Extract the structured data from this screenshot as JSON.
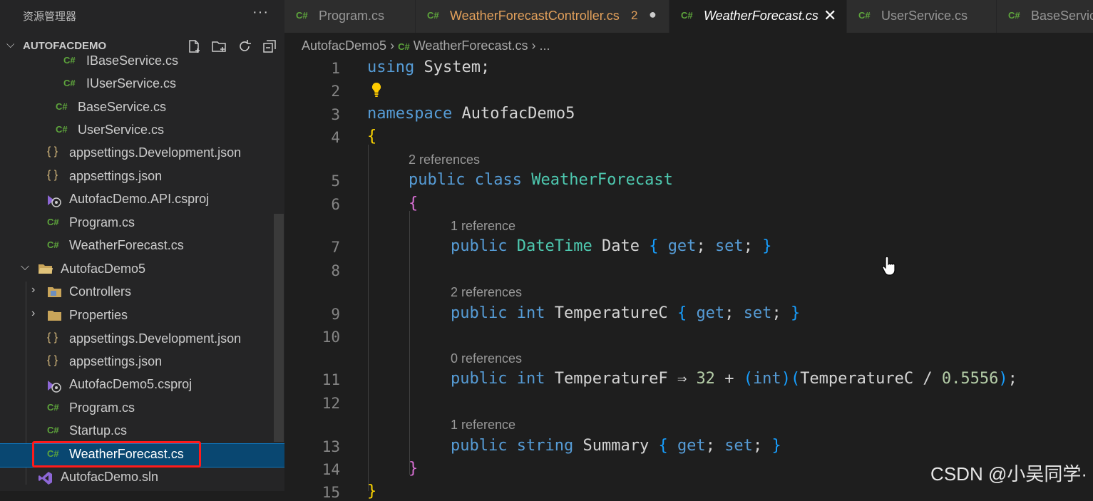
{
  "sidebar": {
    "title": "资源管理器",
    "more": "···",
    "project": "AUTOFACDEMO",
    "items": [
      {
        "label": "IBaseService.cs",
        "icon": "C#"
      },
      {
        "label": "IUserService.cs",
        "icon": "C#"
      },
      {
        "label": "BaseService.cs",
        "icon": "C#"
      },
      {
        "label": "UserService.cs",
        "icon": "C#"
      },
      {
        "label": "appsettings.Development.json",
        "icon": "{ }"
      },
      {
        "label": "appsettings.json",
        "icon": "{ }"
      },
      {
        "label": "AutofacDemo.API.csproj",
        "icon": "proj"
      },
      {
        "label": "Program.cs",
        "icon": "C#"
      },
      {
        "label": "WeatherForecast.cs",
        "icon": "C#"
      },
      {
        "label": "AutofacDemo5",
        "icon": "folder-open"
      },
      {
        "label": "Controllers",
        "icon": "folder"
      },
      {
        "label": "Properties",
        "icon": "folder"
      },
      {
        "label": "appsettings.Development.json",
        "icon": "{ }"
      },
      {
        "label": "appsettings.json",
        "icon": "{ }"
      },
      {
        "label": "AutofacDemo5.csproj",
        "icon": "proj"
      },
      {
        "label": "Program.cs",
        "icon": "C#"
      },
      {
        "label": "Startup.cs",
        "icon": "C#"
      },
      {
        "label": "WeatherForecast.cs",
        "icon": "C#"
      },
      {
        "label": "AutofacDemo.sln",
        "icon": "sln"
      }
    ]
  },
  "tabs": [
    {
      "label": "Program.cs"
    },
    {
      "label": "WeatherForecastController.cs",
      "badge": "2"
    },
    {
      "label": "WeatherForecast.cs"
    },
    {
      "label": "UserService.cs"
    },
    {
      "label": "BaseService.cs"
    }
  ],
  "breadcrumb": {
    "project": "AutofacDemo5",
    "file": "WeatherForecast.cs",
    "more": "..."
  },
  "editor": {
    "line_numbers": [
      "1",
      "2",
      "3",
      "4",
      "5",
      "6",
      "7",
      "8",
      "9",
      "10",
      "11",
      "12",
      "13",
      "14",
      "15"
    ],
    "lenses": [
      "2 references",
      "1 reference",
      "2 references",
      "0 references",
      "1 reference"
    ],
    "tokens": {
      "using": "using",
      "system": " System;",
      "namespace": "namespace",
      "ns_name": " AutofacDemo5",
      "public": "public",
      "class": "class",
      "class_name": "WeatherForecast",
      "datetime": "DateTime",
      "date": "Date",
      "get": "get",
      "set": "set",
      "int": "int",
      "tempc": "TemperatureC",
      "tempf": "TemperatureF",
      "arrow": "⇒",
      "n32": "32",
      "plus": "+",
      "div": "/",
      "n05556": "0.5556",
      "string": "string",
      "summary": "Summary",
      "lbrace": "{",
      "rbrace": "}",
      "lparen": "(",
      "rparen": ")",
      "semi": ";"
    }
  },
  "watermark": "CSDN @小吴同学·"
}
